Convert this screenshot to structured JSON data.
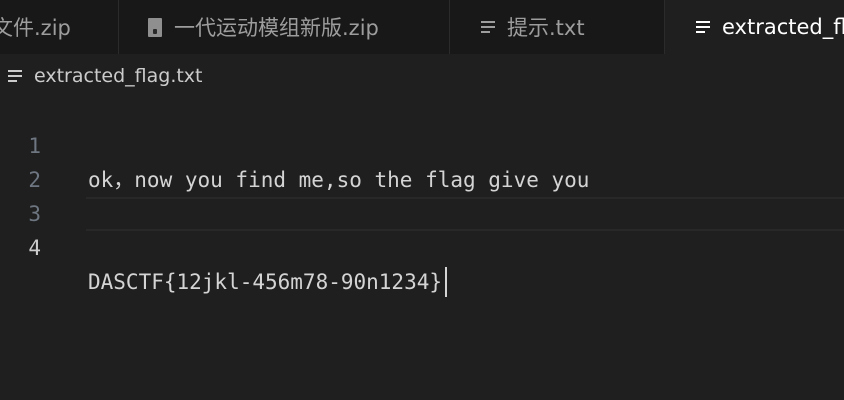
{
  "tabs": [
    {
      "label": "文件.zip",
      "icon": "zip-file-icon"
    },
    {
      "label": "一代运动模组新版.zip",
      "icon": "zip-file-icon"
    },
    {
      "label": "提示.txt",
      "icon": "text-file-icon"
    },
    {
      "label": "extracted_flag.txt",
      "icon": "text-file-icon"
    }
  ],
  "active_tab": 3,
  "breadcrumb": {
    "file": "extracted_flag.txt",
    "icon": "text-file-icon"
  },
  "editor": {
    "current_line": 4,
    "lines": [
      {
        "number": "1",
        "text": "ok，now you find me,so the flag give you"
      },
      {
        "number": "2",
        "text": ""
      },
      {
        "number": "3",
        "text": ""
      },
      {
        "number": "4",
        "text": "DASCTF{12jkl-456m78-90n1234}"
      }
    ]
  },
  "colors": {
    "editor_background": "#1f1f1f",
    "tab_bar_background": "#181818",
    "active_tab_text": "#ffffff",
    "inactive_tab_text": "#9d9d9d",
    "line_number": "#6e7681"
  }
}
